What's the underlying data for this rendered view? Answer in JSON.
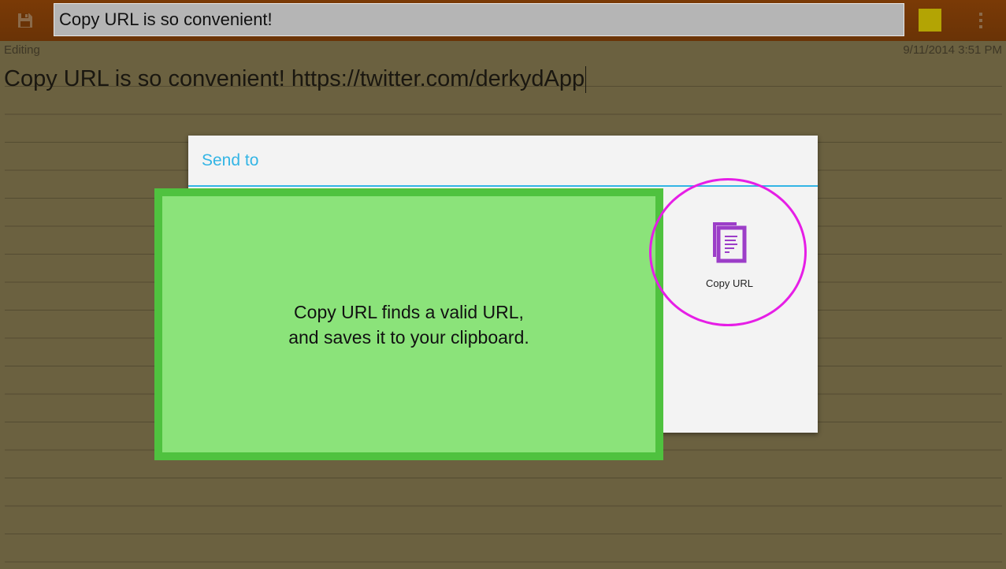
{
  "topbar": {
    "title_value": "Copy URL is so convenient!",
    "save_icon": "save-icon",
    "overflow_icon": "overflow-menu-icon",
    "swatch_color": "#b3a404"
  },
  "note": {
    "status": "Editing",
    "timestamp": "9/11/2014 3:51 PM",
    "body": "Copy URL is so convenient! https://twitter.com/derkydApp"
  },
  "dialog": {
    "title": "Send to",
    "targets": [
      {
        "label": "Copy URL",
        "icon": "copy-url-icon"
      }
    ]
  },
  "callout": {
    "line1": "Copy URL finds a valid URL,",
    "line2": "and saves it to your clipboard."
  },
  "colors": {
    "accent": "#33b5e5",
    "highlight": "#e61ee6",
    "callout_fill": "#8be37a",
    "callout_border": "#4fc23f",
    "icon_purple": "#9c3ec8"
  }
}
